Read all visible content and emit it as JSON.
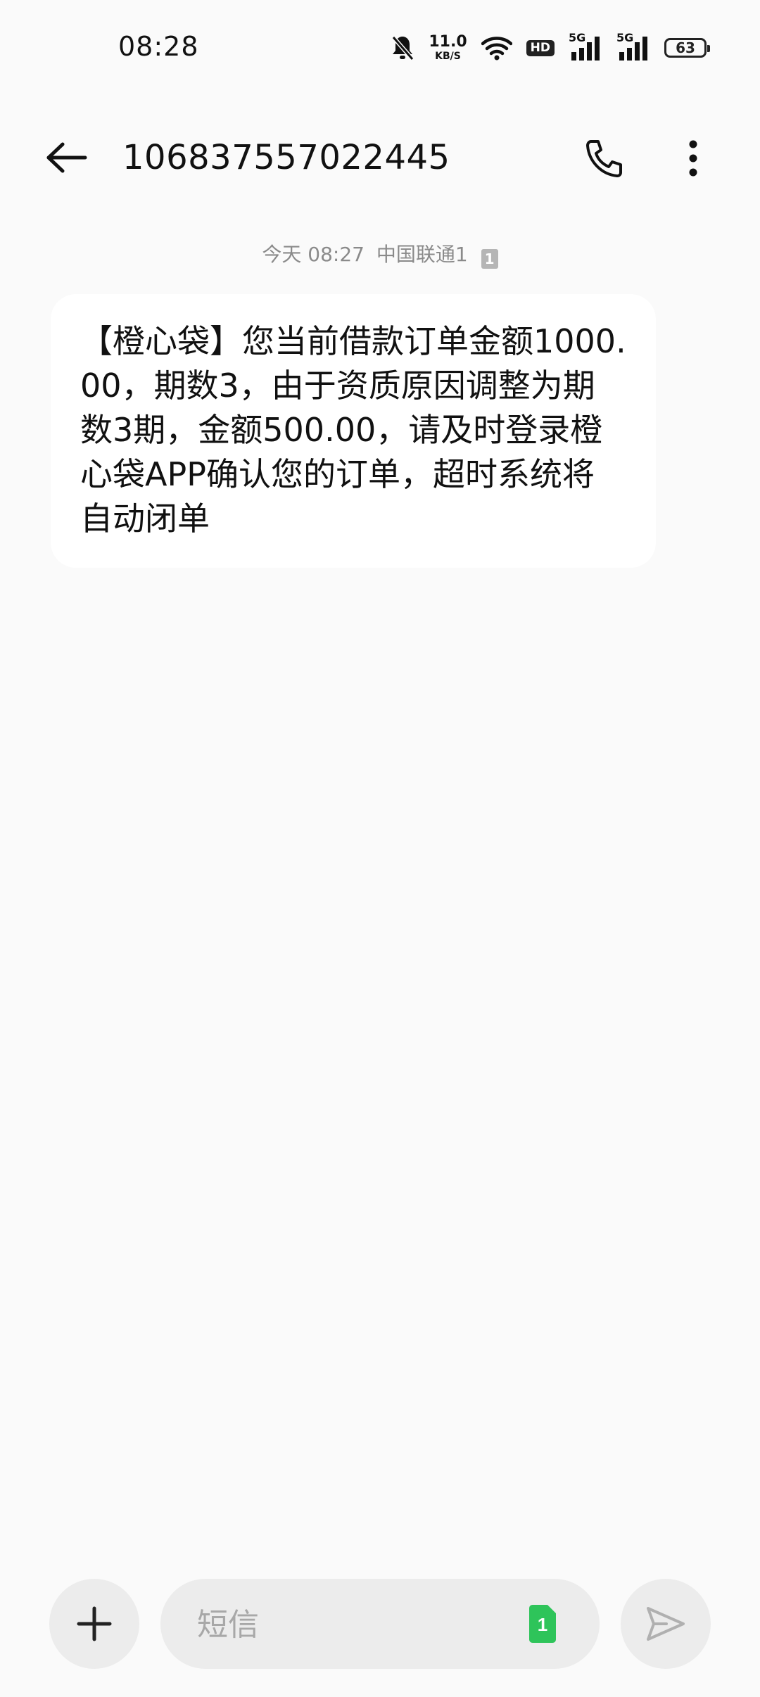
{
  "status_bar": {
    "time": "08:28",
    "net_speed_value": "11.0",
    "net_speed_unit": "KB/S",
    "hd_label": "HD",
    "sim1_network": "5G",
    "sim2_network": "5G",
    "battery_level": "63",
    "icons": [
      "bell-muted-icon",
      "wifi-icon",
      "hd-icon",
      "signal-5g-icon",
      "signal-5g-icon",
      "battery-icon"
    ]
  },
  "app_bar": {
    "contact_number": "106837557022445",
    "icons": [
      "back-arrow-icon",
      "phone-icon",
      "more-vertical-icon"
    ]
  },
  "messages": [
    {
      "meta": {
        "day": "今天",
        "time": "08:27",
        "carrier": "中国联通1",
        "sim": "1"
      },
      "text": "【橙心袋】您当前借款订单金额1000.00，期数3，由于资质原因调整为期数3期，金额500.00，请及时登录橙心袋APP确认您的订单，超时系统将自动闭单"
    }
  ],
  "composer": {
    "placeholder": "短信",
    "sim_label": "1",
    "icons": [
      "plus-icon",
      "sim-card-icon",
      "send-icon"
    ]
  },
  "colors": {
    "background": "#fafafa",
    "bubble": "#ffffff",
    "sim_green": "#2ec45a",
    "muted_text": "#8a8a8a"
  }
}
